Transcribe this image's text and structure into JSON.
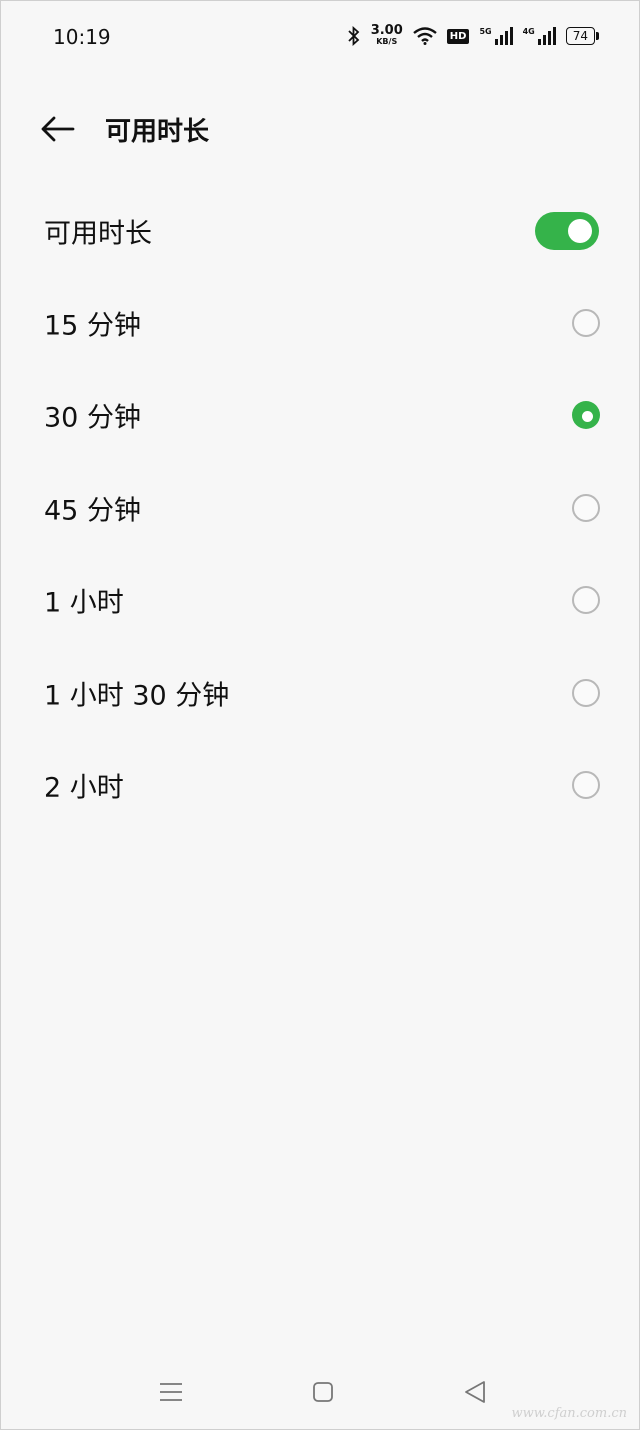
{
  "status_bar": {
    "time": "10:19",
    "speed_value": "3.00",
    "speed_unit": "KB/S",
    "hd_label": "HD",
    "net1_label": "5G",
    "net2_label": "4G",
    "battery": "74"
  },
  "header": {
    "title": "可用时长",
    "back_icon": "arrow-left-icon"
  },
  "settings": {
    "toggle_label": "可用时长",
    "toggle_on": true,
    "options": [
      {
        "label": "15 分钟",
        "selected": false
      },
      {
        "label": "30 分钟",
        "selected": true
      },
      {
        "label": "45 分钟",
        "selected": false
      },
      {
        "label": "1 小时",
        "selected": false
      },
      {
        "label": "1 小时 30 分钟",
        "selected": false
      },
      {
        "label": "2 小时",
        "selected": false
      }
    ]
  },
  "navbar": {
    "icons": [
      "menu-icon",
      "home-icon",
      "back-triangle-icon"
    ]
  },
  "watermark": "www.cfan.com.cn",
  "colors": {
    "accent": "#35b34a",
    "background": "#f7f7f7",
    "radio_border": "#b8b8b8"
  }
}
